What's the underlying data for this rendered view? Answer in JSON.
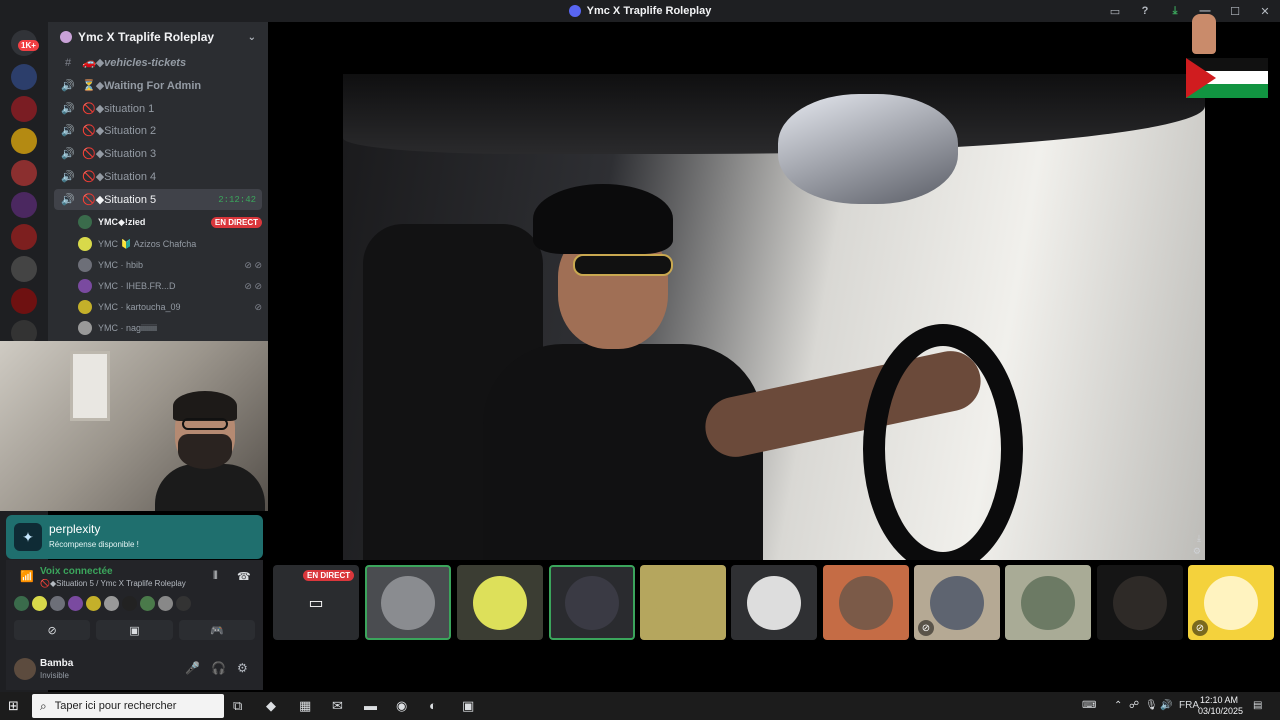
{
  "window": {
    "title": "Ymc X Traplife Roleplay"
  },
  "servers": {
    "badge": "1K+"
  },
  "guild": {
    "name": "Ymc X Traplife Roleplay"
  },
  "channels": [
    {
      "name": "🚗◆vehicles-tickets",
      "icon": "hash-icon"
    },
    {
      "name": "⏳◆Waiting For Admin",
      "icon": "speaker-icon"
    },
    {
      "name": "🚫◆situation 1",
      "icon": "speaker-icon"
    },
    {
      "name": "🚫◆Situation 2",
      "icon": "speaker-icon"
    },
    {
      "name": "🚫◆Situation 3",
      "icon": "speaker-icon"
    },
    {
      "name": "🚫◆Situation 4",
      "icon": "speaker-icon"
    },
    {
      "name": "🚫◆Situation 5",
      "icon": "speaker-icon",
      "time": "2:12:42"
    }
  ],
  "voice_users": [
    {
      "name": "YMC◆!zied",
      "live": "EN DIRECT"
    },
    {
      "name": "YMC 🔰 Azizos Chafcha"
    },
    {
      "name": "YMC · hbib"
    },
    {
      "name": "YMC · IHEB.FR...D"
    },
    {
      "name": "YMC · kartoucha_09"
    },
    {
      "name": "YMC · nagiiiiiiii"
    }
  ],
  "promo": {
    "name": "perplexity",
    "sub": "Récompense disponible !"
  },
  "voice": {
    "status": "Voix connectée",
    "location": "🚫◆Situation 5 / Ymc X Traplife Roleplay"
  },
  "user": {
    "name": "Bamba",
    "status": "Invisible"
  },
  "stream_tiles": [
    {
      "live": "EN DIRECT"
    }
  ],
  "taskbar": {
    "search_placeholder": "Taper ici pour rechercher",
    "lang": "FRA",
    "time": "12:10 AM",
    "date": "03/10/2025"
  }
}
